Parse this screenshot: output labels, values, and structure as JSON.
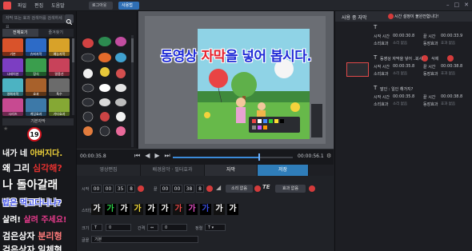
{
  "app": {
    "menu": [
      "파일",
      "편집",
      "도움말"
    ],
    "login_btn": "로그아웃",
    "subtitle_btn": "사용법"
  },
  "left": {
    "search_placeholder": "자막 또는 효과 검색어를 검색하세요",
    "tabs": [
      "전체보기",
      "즐겨찾기"
    ],
    "thumbs": [
      {
        "label": "기본",
        "color": "#d9532b"
      },
      {
        "label": "슈퍼자막",
        "color": "#2d6bc7"
      },
      {
        "label": "예능자막",
        "color": "#d8a229"
      },
      {
        "label": "나레이션",
        "color": "#7c3ec2"
      },
      {
        "label": "장식",
        "color": "#3a9e4d"
      },
      {
        "label": "말풍선",
        "color": "#c8425a"
      },
      {
        "label": "영화자막",
        "color": "#4cb3c2"
      },
      {
        "label": "효과",
        "color": "#a8612b"
      },
      {
        "label": "특수",
        "color": "#6b6b6b"
      },
      {
        "label": "시리즈",
        "color": "#c74a91"
      },
      {
        "label": "게임효과",
        "color": "#3d79a8"
      },
      {
        "label": "기타효과",
        "color": "#85a834"
      }
    ],
    "preset_header": "기본자막",
    "badge": "19",
    "presets": [
      {
        "id": "p1",
        "text_a": "내가 네 ",
        "text_b": "아버지다.",
        "color_a": "#ffffff",
        "color_b": "#f2d43a"
      },
      {
        "id": "p2",
        "text_a": "왜 그리 ",
        "text_b": "심각해?",
        "color_a": "#ffffff",
        "color_b": "#e3312f"
      },
      {
        "id": "p3",
        "text_a": "나 돌아갈래",
        "text_b": "",
        "color_a": "#ffffff",
        "color_b": "#ffffff"
      },
      {
        "id": "p4",
        "text_a": "밥은 먹고다니냐?",
        "text_b": "",
        "color_a": "#3c4de6",
        "color_b": "#3c4de6"
      },
      {
        "id": "p5",
        "text_a": "살려! ",
        "text_b": "살려 주세요!",
        "color_a": "#ffffff",
        "color_b": "#e33a8a"
      },
      {
        "id": "p6",
        "text_a": "검은상자 ",
        "text_b": "분리형",
        "color_a": "#ffffff",
        "color_b": "#ff7a7a"
      },
      {
        "id": "p7",
        "text_a": "검은상자 일체형",
        "text_b": "",
        "color_a": "#ffffff",
        "color_b": "#ffffff"
      }
    ]
  },
  "preview": {
    "subtitle_a": "동영상 ",
    "subtitle_b": "자막",
    "subtitle_c": "을 넣어 봅시다."
  },
  "timeline": {
    "current": "00:00:35.8",
    "total": "00:00:56.1",
    "progress": 0.72
  },
  "editor": {
    "tabs": [
      "영상편집",
      "배경음악 · 필터효과",
      "자막",
      "저장"
    ],
    "active_tab": "자막",
    "start_label": "시작",
    "start_parts": [
      "00",
      "00",
      "35",
      "8"
    ],
    "end_label": "끝",
    "end_parts": [
      "00",
      "00",
      "38",
      "8"
    ],
    "sound_label": "소리 없음",
    "effect_label": "효과 없음",
    "style_label": "스타일",
    "swatch_char": "가",
    "swatch_colors": [
      "#ffffff",
      "#2fd14a",
      "#ffffff",
      "#f1d93a",
      "#ffffff",
      "#ffffff",
      "#e54848",
      "#e14ec3",
      "#3a4de0",
      "#ffffff",
      "#ffffff"
    ],
    "size_label": "크기",
    "size_value": "0",
    "gap_label": "간격",
    "gap_value": "0",
    "align_label": "정렬",
    "font_label": "글꼴",
    "font_value": "기본"
  },
  "right": {
    "title": "사용 중 자막",
    "warning": "시간 설정이 불완전합니다!",
    "entries": [
      {
        "text": "",
        "start": "00:00:30.8",
        "end": "00:00:33.9",
        "sound": "소리 없음",
        "effect": "효과 없음"
      },
      {
        "text": "동영상 자막을 넣어 ...",
        "start": "00:00:35.8",
        "end": "00:00:38.8",
        "sound": "소리 없음",
        "effect": "효과 없음"
      },
      {
        "text": "말인 : 일인 해가지?",
        "start": "00:00:35.8",
        "end": "00:00:38.8",
        "sound": "소리 없음",
        "effect": "효과 없음"
      }
    ],
    "start_lbl": "시작 시간",
    "end_lbl": "끝 시간",
    "sound_lbl": "소리효과",
    "effect_lbl": "동장효과",
    "edit_lbl": "복사",
    "del_lbl": "삭제"
  }
}
